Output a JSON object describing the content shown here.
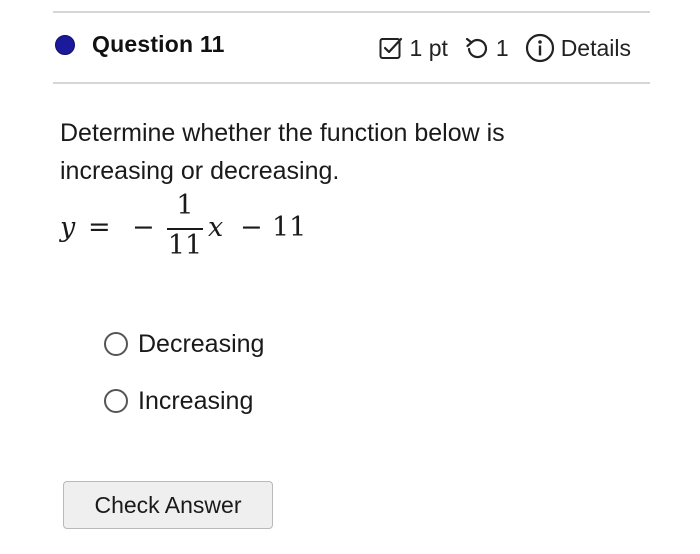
{
  "header": {
    "question_title": "Question 11",
    "points": "1 pt",
    "attempts": "1",
    "details_label": "Details",
    "icons": {
      "status": "question-status-dot",
      "points": "checkbox-icon",
      "attempts": "retry-icon",
      "details": "info-icon"
    },
    "colors": {
      "status_dot": "#1a1a9a"
    }
  },
  "prompt": {
    "text": "Determine whether the function below is increasing or decreasing."
  },
  "equation": {
    "lhs": "y",
    "equals": "=",
    "sign": "−",
    "numerator": "1",
    "denominator": "11",
    "variable": "x",
    "operator": "−",
    "constant": "11"
  },
  "options": [
    {
      "label": "Decreasing",
      "selected": false
    },
    {
      "label": "Increasing",
      "selected": false
    }
  ],
  "actions": {
    "check_answer": "Check Answer"
  }
}
